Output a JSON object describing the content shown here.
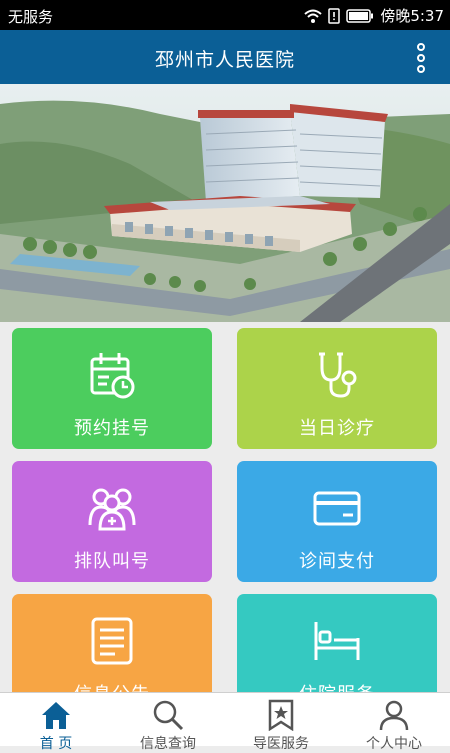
{
  "status_bar": {
    "carrier": "无服务",
    "time": "傍晚5:37"
  },
  "header": {
    "title": "邳州市人民医院",
    "menu_icon": "more-vertical-icon"
  },
  "banner": {
    "alt_icon": "hospital-building-image"
  },
  "tiles": [
    {
      "label": "预约挂号",
      "icon": "calendar-clock-icon",
      "color": "#4ccd5e"
    },
    {
      "label": "当日诊疗",
      "icon": "stethoscope-icon",
      "color": "#acd34a"
    },
    {
      "label": "排队叫号",
      "icon": "people-queue-icon",
      "color": "#c36ae0"
    },
    {
      "label": "诊间支付",
      "icon": "card-icon",
      "color": "#3ba9e6"
    },
    {
      "label": "信息公告",
      "icon": "notice-board-icon",
      "color": "#f7a544"
    },
    {
      "label": "住院服务",
      "icon": "hospital-bed-icon",
      "color": "#35c9c1"
    }
  ],
  "tabs": [
    {
      "label": "首 页",
      "icon": "home-icon"
    },
    {
      "label": "信息查询",
      "icon": "search-icon"
    },
    {
      "label": "导医服务",
      "icon": "bookmark-star-icon"
    },
    {
      "label": "个人中心",
      "icon": "user-icon"
    }
  ],
  "colors": {
    "appbar": "#0b5f96",
    "tab_active": "#0b5f96"
  }
}
